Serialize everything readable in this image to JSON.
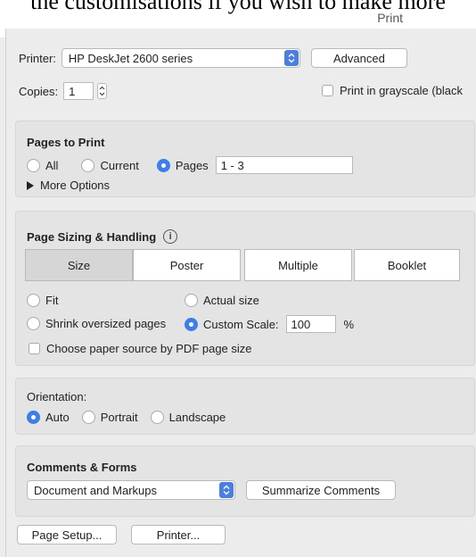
{
  "document_text": "the customisations if you wish to make more",
  "window_title": "Print",
  "printer": {
    "label": "Printer:",
    "value": "HP DeskJet 2600 series",
    "advanced_label": "Advanced"
  },
  "copies": {
    "label": "Copies:",
    "value": "1",
    "grayscale_label": "Print in grayscale (black"
  },
  "pages_to_print": {
    "title": "Pages to Print",
    "all_label": "All",
    "current_label": "Current",
    "pages_label": "Pages",
    "pages_value": "1 - 3",
    "more_options_label": "More Options",
    "selected": "pages"
  },
  "sizing": {
    "title": "Page Sizing & Handling",
    "tabs": [
      "Size",
      "Poster",
      "Multiple",
      "Booklet"
    ],
    "active_tab": "Size",
    "fit_label": "Fit",
    "actual_size_label": "Actual size",
    "shrink_label": "Shrink oversized pages",
    "custom_scale_label": "Custom Scale:",
    "custom_scale_value": "100",
    "percent": "%",
    "paper_source_label": "Choose paper source by PDF page size",
    "selected": "custom_scale"
  },
  "orientation": {
    "title": "Orientation:",
    "auto_label": "Auto",
    "portrait_label": "Portrait",
    "landscape_label": "Landscape",
    "selected": "auto"
  },
  "comments": {
    "title": "Comments & Forms",
    "value": "Document and Markups",
    "summarize_label": "Summarize Comments"
  },
  "footer": {
    "page_setup_label": "Page Setup...",
    "printer_label": "Printer..."
  },
  "colors": {
    "accent": "#3d7ee8",
    "panel": "#e4e4e4",
    "window": "#ececec"
  },
  "icons": {
    "select_arrows": "chevron-updown-icon",
    "disclosure": "triangle-right-icon",
    "info": "info-icon"
  }
}
